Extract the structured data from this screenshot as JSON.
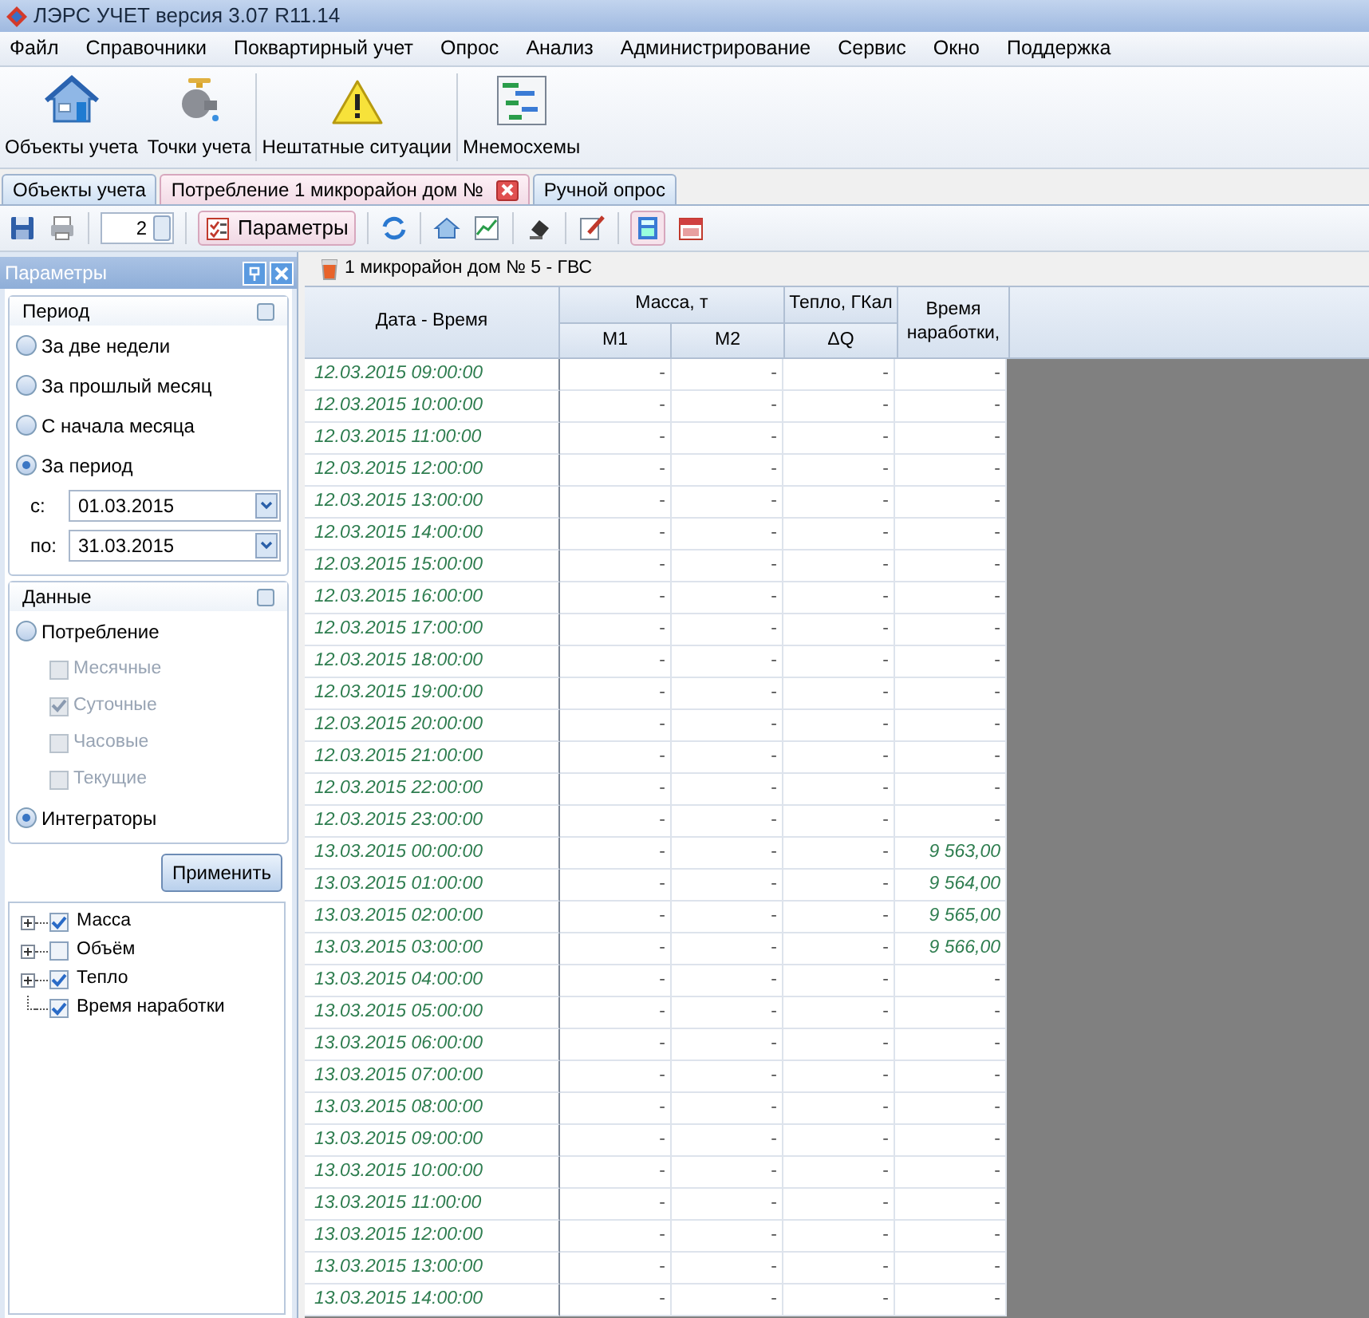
{
  "window": {
    "title": "ЛЭРС УЧЕТ версия 3.07 R11.14"
  },
  "menu": [
    "Файл",
    "Справочники",
    "Поквартирный учет",
    "Опрос",
    "Анализ",
    "Администрирование",
    "Сервис",
    "Окно",
    "Поддержка"
  ],
  "ribbon": [
    {
      "kind": "house",
      "label": "Объекты учета"
    },
    {
      "kind": "tap",
      "label": "Точки учета"
    },
    {
      "kind": "warning",
      "label": "Нештатные ситуации"
    },
    {
      "kind": "scheme",
      "label": "Мнемосхемы"
    }
  ],
  "tabs": [
    {
      "label": "Объекты учета",
      "selected": false
    },
    {
      "label": "Потребление 1 микрорайон дом №",
      "selected": true
    },
    {
      "label": "Ручной опрос",
      "selected": false
    }
  ],
  "toolbar": {
    "counter": "2",
    "params_button": "Параметры"
  },
  "panel": {
    "title": "Параметры",
    "period": {
      "title": "Период",
      "options": [
        {
          "label": "За две недели",
          "selected": false
        },
        {
          "label": "За прошлый месяц",
          "selected": false
        },
        {
          "label": "С начала месяца",
          "selected": false
        },
        {
          "label": "За период",
          "selected": true
        }
      ],
      "from_label": "с:",
      "from": "01.03.2015",
      "to_label": "по:",
      "to": "31.03.2015"
    },
    "data": {
      "title": "Данные",
      "consumption": {
        "label": "Потребление",
        "selected": false
      },
      "checks": [
        {
          "label": "Месячные",
          "checked": false,
          "disabled": true
        },
        {
          "label": "Суточные",
          "checked": true,
          "disabled": true
        },
        {
          "label": "Часовые",
          "checked": false,
          "disabled": true
        },
        {
          "label": "Текущие",
          "checked": false,
          "disabled": true
        }
      ],
      "integrators": {
        "label": "Интеграторы",
        "selected": true
      }
    },
    "apply": "Применить",
    "tree": [
      {
        "label": "Масса",
        "checked": true,
        "kind": "group"
      },
      {
        "label": "Объём",
        "checked": false,
        "kind": "group"
      },
      {
        "label": "Тепло",
        "checked": true,
        "kind": "group"
      },
      {
        "label": "Время наработки",
        "checked": true,
        "kind": "leaf"
      }
    ]
  },
  "document": {
    "title": "1 микрорайон дом № 5 - ГВС"
  },
  "table": {
    "date_column": "Дата - Время",
    "groups": [
      {
        "label": "Масса, т",
        "columns": [
          "M1",
          "M2"
        ]
      },
      {
        "label": "Тепло, ГКал",
        "columns": [
          "ΔQ"
        ]
      }
    ],
    "last_column": "Время наработки,",
    "rows": [
      {
        "date": "12.03.2015 09:00:00",
        "cells": [
          "-",
          "-",
          "-",
          "-"
        ]
      },
      {
        "date": "12.03.2015 10:00:00",
        "cells": [
          "-",
          "-",
          "-",
          "-"
        ]
      },
      {
        "date": "12.03.2015 11:00:00",
        "cells": [
          "-",
          "-",
          "-",
          "-"
        ]
      },
      {
        "date": "12.03.2015 12:00:00",
        "cells": [
          "-",
          "-",
          "-",
          "-"
        ]
      },
      {
        "date": "12.03.2015 13:00:00",
        "cells": [
          "-",
          "-",
          "-",
          "-"
        ]
      },
      {
        "date": "12.03.2015 14:00:00",
        "cells": [
          "-",
          "-",
          "-",
          "-"
        ]
      },
      {
        "date": "12.03.2015 15:00:00",
        "cells": [
          "-",
          "-",
          "-",
          "-"
        ]
      },
      {
        "date": "12.03.2015 16:00:00",
        "cells": [
          "-",
          "-",
          "-",
          "-"
        ]
      },
      {
        "date": "12.03.2015 17:00:00",
        "cells": [
          "-",
          "-",
          "-",
          "-"
        ]
      },
      {
        "date": "12.03.2015 18:00:00",
        "cells": [
          "-",
          "-",
          "-",
          "-"
        ]
      },
      {
        "date": "12.03.2015 19:00:00",
        "cells": [
          "-",
          "-",
          "-",
          "-"
        ]
      },
      {
        "date": "12.03.2015 20:00:00",
        "cells": [
          "-",
          "-",
          "-",
          "-"
        ]
      },
      {
        "date": "12.03.2015 21:00:00",
        "cells": [
          "-",
          "-",
          "-",
          "-"
        ]
      },
      {
        "date": "12.03.2015 22:00:00",
        "cells": [
          "-",
          "-",
          "-",
          "-"
        ]
      },
      {
        "date": "12.03.2015 23:00:00",
        "cells": [
          "-",
          "-",
          "-",
          "-"
        ]
      },
      {
        "date": "13.03.2015 00:00:00",
        "cells": [
          "-",
          "-",
          "-",
          "9 563,00"
        ]
      },
      {
        "date": "13.03.2015 01:00:00",
        "cells": [
          "-",
          "-",
          "-",
          "9 564,00"
        ]
      },
      {
        "date": "13.03.2015 02:00:00",
        "cells": [
          "-",
          "-",
          "-",
          "9 565,00"
        ]
      },
      {
        "date": "13.03.2015 03:00:00",
        "cells": [
          "-",
          "-",
          "-",
          "9 566,00"
        ]
      },
      {
        "date": "13.03.2015 04:00:00",
        "cells": [
          "-",
          "-",
          "-",
          "-"
        ]
      },
      {
        "date": "13.03.2015 05:00:00",
        "cells": [
          "-",
          "-",
          "-",
          "-"
        ]
      },
      {
        "date": "13.03.2015 06:00:00",
        "cells": [
          "-",
          "-",
          "-",
          "-"
        ]
      },
      {
        "date": "13.03.2015 07:00:00",
        "cells": [
          "-",
          "-",
          "-",
          "-"
        ]
      },
      {
        "date": "13.03.2015 08:00:00",
        "cells": [
          "-",
          "-",
          "-",
          "-"
        ]
      },
      {
        "date": "13.03.2015 09:00:00",
        "cells": [
          "-",
          "-",
          "-",
          "-"
        ]
      },
      {
        "date": "13.03.2015 10:00:00",
        "cells": [
          "-",
          "-",
          "-",
          "-"
        ]
      },
      {
        "date": "13.03.2015 11:00:00",
        "cells": [
          "-",
          "-",
          "-",
          "-"
        ]
      },
      {
        "date": "13.03.2015 12:00:00",
        "cells": [
          "-",
          "-",
          "-",
          "-"
        ]
      },
      {
        "date": "13.03.2015 13:00:00",
        "cells": [
          "-",
          "-",
          "-",
          "-"
        ]
      },
      {
        "date": "13.03.2015 14:00:00",
        "cells": [
          "-",
          "-",
          "-",
          "-"
        ]
      }
    ]
  }
}
